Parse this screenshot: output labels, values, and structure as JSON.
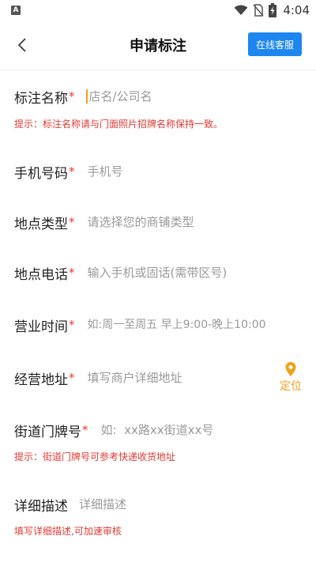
{
  "status_bar": {
    "time": "4:04",
    "app_badge": "A"
  },
  "header": {
    "title": "申请标注",
    "service_label": "在线客服"
  },
  "form": {
    "name": {
      "label": "标注名称",
      "required": "*",
      "placeholder": "店名/公司名",
      "hint": "提示：标注名称请与门面照片招牌名称保持一致。"
    },
    "phone": {
      "label": "手机号码",
      "required": "*",
      "placeholder": "手机号"
    },
    "type": {
      "label": "地点类型",
      "required": "*",
      "placeholder": "请选择您的商铺类型"
    },
    "tel": {
      "label": "地点电话",
      "required": "*",
      "placeholder": "输入手机或固话(需带区号)"
    },
    "hours": {
      "label": "营业时间",
      "required": "*",
      "placeholder": "如:周一至周五 早上9:00-晚上10:00"
    },
    "address": {
      "label": "经营地址",
      "required": "*",
      "placeholder": "填写商户详细地址",
      "locate_label": "定位"
    },
    "street_no": {
      "label": "街道门牌号",
      "required": "*",
      "placeholder": "如:  xx路xx街道xx号",
      "hint": "提示：街道门牌号可参考快递收货地址"
    },
    "description": {
      "label": "详细描述",
      "placeholder": "详细描述",
      "hint": "填写详细描述,可加速审核"
    }
  },
  "colors": {
    "accent_blue": "#1e86f0",
    "required_red": "#e53935",
    "locate_orange": "#f0a21a"
  }
}
